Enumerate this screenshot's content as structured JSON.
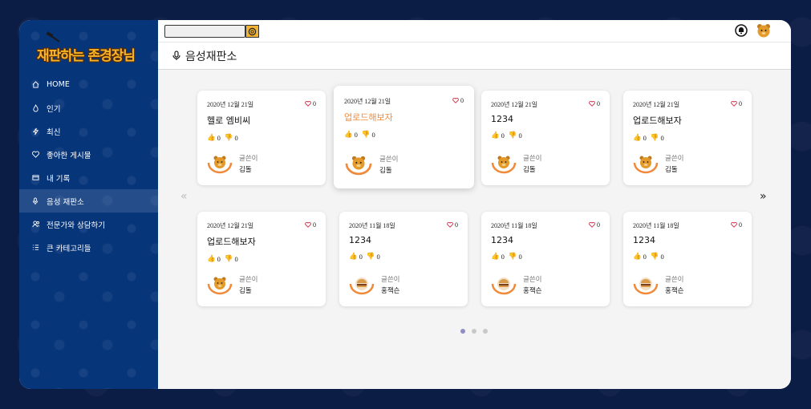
{
  "app": {
    "logo_text": "재판하는 존경장님"
  },
  "sidebar": {
    "items": [
      {
        "label": "HOME",
        "icon": "home-icon"
      },
      {
        "label": "인기",
        "icon": "fire-icon"
      },
      {
        "label": "최신",
        "icon": "bolt-icon"
      },
      {
        "label": "좋아한 게시물",
        "icon": "heart-icon"
      },
      {
        "label": "내 기록",
        "icon": "folder-icon"
      },
      {
        "label": "음성 재판소",
        "icon": "mic-icon",
        "active": true
      },
      {
        "label": "전문가와 상담하기",
        "icon": "people-icon"
      },
      {
        "label": "큰 카테고리들",
        "icon": "list-icon"
      }
    ]
  },
  "topbar": {
    "search_value": ""
  },
  "page": {
    "title": "음성재판소"
  },
  "cards": [
    {
      "date": "2020년 12월 21일",
      "likes": "0",
      "title": "헬로 엠비씨",
      "up": "0",
      "down": "0",
      "author_label": "글쓴이",
      "author": "김돌",
      "avatar": "bear"
    },
    {
      "date": "2020년 12월 21일",
      "likes": "0",
      "title": "업로드해보자",
      "up": "0",
      "down": "0",
      "author_label": "글쓴이",
      "author": "김돌",
      "avatar": "bear",
      "highlight": true
    },
    {
      "date": "2020년 12월 21일",
      "likes": "0",
      "title": "1234",
      "up": "0",
      "down": "0",
      "author_label": "글쓴이",
      "author": "김돌",
      "avatar": "bear"
    },
    {
      "date": "2020년 12월 21일",
      "likes": "0",
      "title": "업로드해보자",
      "up": "0",
      "down": "0",
      "author_label": "글쓴이",
      "author": "김돌",
      "avatar": "bear"
    },
    {
      "date": "2020년 12월 21일",
      "likes": "0",
      "title": "업로드해보자",
      "up": "0",
      "down": "0",
      "author_label": "글쓴이",
      "author": "김돌",
      "avatar": "bear"
    },
    {
      "date": "2020년 11월 18일",
      "likes": "0",
      "title": "1234",
      "up": "0",
      "down": "0",
      "author_label": "글쓴이",
      "author": "홍잭슨",
      "avatar": "burger"
    },
    {
      "date": "2020년 11월 18일",
      "likes": "0",
      "title": "1234",
      "up": "0",
      "down": "0",
      "author_label": "글쓴이",
      "author": "홍잭슨",
      "avatar": "burger"
    },
    {
      "date": "2020년 11월 18일",
      "likes": "0",
      "title": "1234",
      "up": "0",
      "down": "0",
      "author_label": "글쓴이",
      "author": "홍잭슨",
      "avatar": "burger"
    }
  ],
  "pagination": {
    "prev": "«",
    "next": "»",
    "pages": 3,
    "current": 1
  },
  "colors": {
    "sidebar": "#07357a",
    "accent": "#f08a3a",
    "logo": "#f7b52a",
    "heart": "#d0324b"
  }
}
